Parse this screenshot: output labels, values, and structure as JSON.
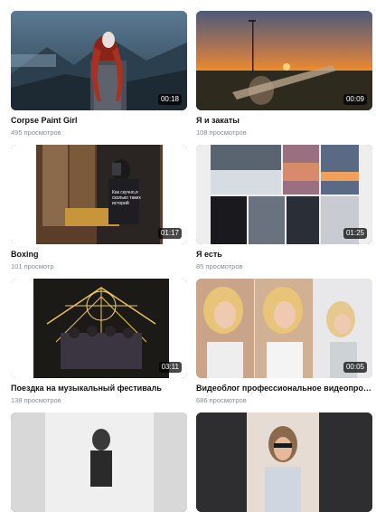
{
  "videos": [
    {
      "title": "Corpse Paint Girl",
      "views": "495 просмотров",
      "duration": "00:18",
      "thumbnail": "girl-with-red-hair-on-mountain"
    },
    {
      "title": "Я и закаты",
      "views": "108 просмотров",
      "duration": "00:09",
      "thumbnail": "sunset-field"
    },
    {
      "title": "Boxing",
      "views": "101 просмотр",
      "duration": "01:17",
      "thumbnail": "mirror-selfie-locker-room",
      "overlay_text": "Как скучно,я сколько таких историй"
    },
    {
      "title": "Я есть",
      "views": "85 просмотров",
      "duration": "01:25",
      "thumbnail": "collage-snow-sunset"
    },
    {
      "title": "Поездка на музыкальный фестиваль",
      "views": "138 просмотров",
      "duration": "03:11",
      "thumbnail": "festival-group-lights"
    },
    {
      "title": "Видеоблог профессиональное видеопроиз...",
      "views": "686 просмотров",
      "duration": "00:05",
      "thumbnail": "blonde-girl-split-screen"
    },
    {
      "title": "",
      "views": "",
      "duration": "",
      "thumbnail": "girl-in-white-room"
    },
    {
      "title": "",
      "views": "",
      "duration": "",
      "thumbnail": "girl-with-sunglasses"
    }
  ],
  "colors": {
    "title": "#111111",
    "meta": "#818c99",
    "duration_bg": "rgba(0,0,0,0.72)"
  }
}
